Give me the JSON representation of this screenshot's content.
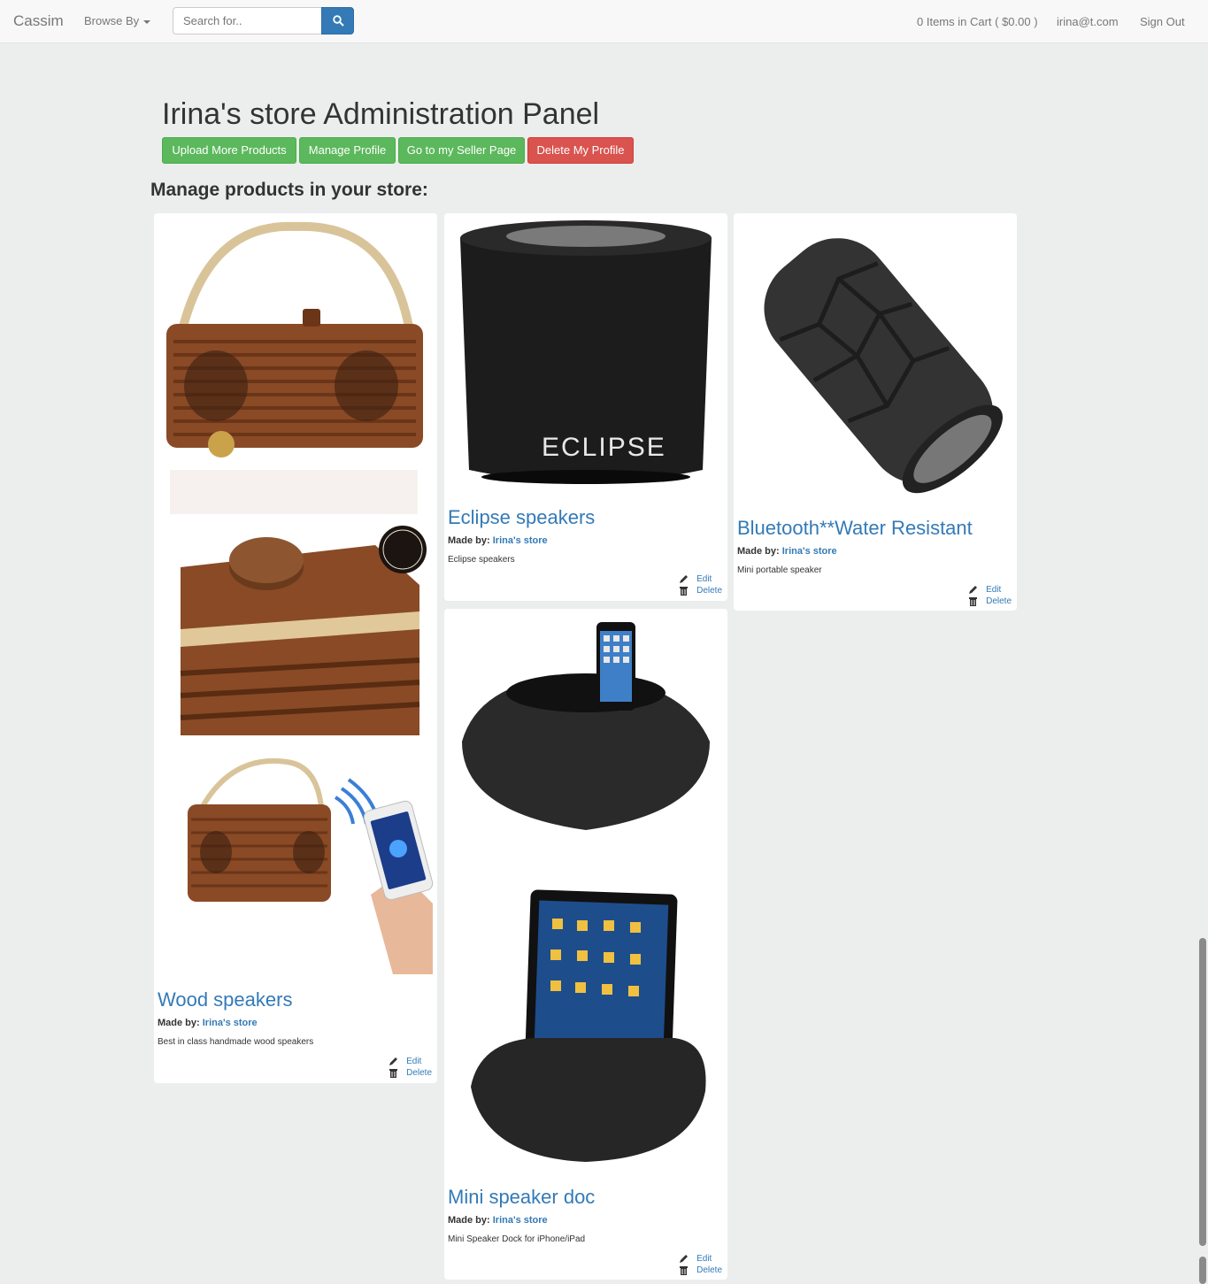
{
  "navbar": {
    "brand": "Cassim",
    "browse_label": "Browse By",
    "search_placeholder": "Search for..",
    "cart": "0 Items in Cart ( $0.00 )",
    "user": "irina@t.com",
    "sign_out": "Sign Out"
  },
  "header": {
    "title": "Irina's store Administration Panel",
    "buttons": {
      "upload": "Upload More Products",
      "manage": "Manage Profile",
      "seller": "Go to my Seller Page",
      "delete_profile": "Delete My Profile"
    },
    "subtitle": "Manage products in your store:"
  },
  "products": [
    {
      "title": "Wood speakers",
      "made_by_label": "Made by:",
      "made_by": "Irina's store",
      "description": "Best in class handmade wood speakers",
      "edit": "Edit",
      "delete": "Delete"
    },
    {
      "title": "Eclipse speakers",
      "made_by_label": "Made by:",
      "made_by": "Irina's store",
      "description": "Eclipse speakers",
      "edit": "Edit",
      "delete": "Delete",
      "image_text": "ECLIPSE"
    },
    {
      "title": "Bluetooth**Water Resistant",
      "made_by_label": "Made by:",
      "made_by": "Irina's store",
      "description": "Mini portable speaker",
      "edit": "Edit",
      "delete": "Delete"
    },
    {
      "title": "Mini speaker doc",
      "made_by_label": "Made by:",
      "made_by": "Irina's store",
      "description": "Mini Speaker Dock for iPhone/iPad",
      "edit": "Edit",
      "delete": "Delete"
    }
  ],
  "colors": {
    "link": "#337ab7",
    "success": "#5cb85c",
    "danger": "#d9534f",
    "background": "#eceeed"
  }
}
